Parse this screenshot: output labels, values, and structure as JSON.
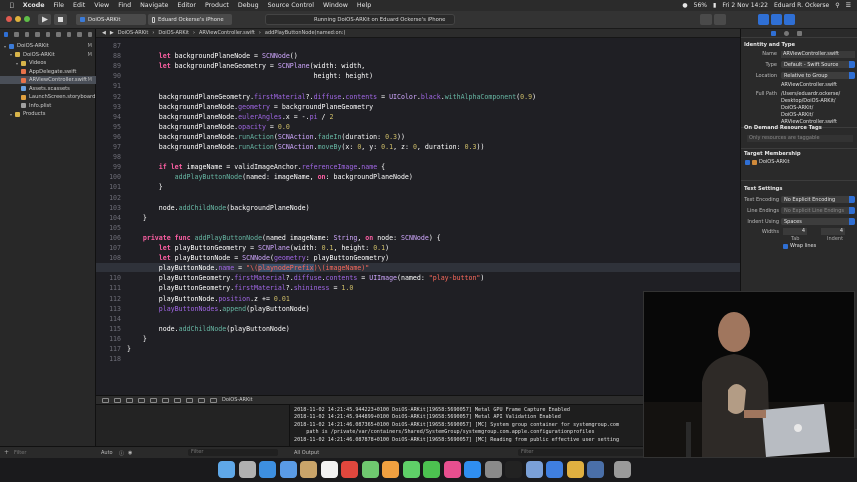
{
  "menubar": {
    "items": [
      "Xcode",
      "File",
      "Edit",
      "View",
      "Find",
      "Navigate",
      "Editor",
      "Product",
      "Debug",
      "Source Control",
      "Window",
      "Help"
    ],
    "battery": "56%",
    "datetime": "Fri 2 Nov 14:22",
    "user": "Eduard R. Ockerse"
  },
  "toolbar": {
    "scheme": "DoiOS-ARKit",
    "device": "Eduard Ockerse's iPhone",
    "activity": "Running DoiOS-ARKit on Eduard Ockerse's iPhone"
  },
  "navigator": {
    "items": [
      {
        "label": "DoiOS-ARKit",
        "badge": "M",
        "level": 0,
        "type": "project"
      },
      {
        "label": "DoiOS-ARKit",
        "badge": "M",
        "level": 1,
        "type": "folder"
      },
      {
        "label": "Videos",
        "badge": "",
        "level": 2,
        "type": "folder"
      },
      {
        "label": "AppDelegate.swift",
        "badge": "",
        "level": 2,
        "type": "swift"
      },
      {
        "label": "ARViewController.swift",
        "badge": "M",
        "level": 2,
        "type": "swift",
        "selected": true
      },
      {
        "label": "Assets.xcassets",
        "badge": "",
        "level": 2,
        "type": "assets"
      },
      {
        "label": "LaunchScreen.storyboard",
        "badge": "",
        "level": 2,
        "type": "storyboard"
      },
      {
        "label": "Info.plist",
        "badge": "",
        "level": 2,
        "type": "plist"
      },
      {
        "label": "Products",
        "badge": "",
        "level": 1,
        "type": "folder"
      }
    ],
    "filter_placeholder": "Filter"
  },
  "jumpbar": {
    "crumbs": [
      "DoiOS-ARKit",
      "DoiOS-ARKit",
      "ARViewController.swift",
      "addPlayButtonNode(named:on:)"
    ]
  },
  "editor": {
    "current_line": 109,
    "lines": [
      {
        "n": 87,
        "t": ""
      },
      {
        "n": 88,
        "t": "        let backgroundPlaneNode = SCNNode()"
      },
      {
        "n": 89,
        "t": "        let backgroundPlaneGeometry = SCNPlane(width: width,"
      },
      {
        "n": 90,
        "t": "                                               height: height)"
      },
      {
        "n": 91,
        "t": ""
      },
      {
        "n": 92,
        "t": "        backgroundPlaneGeometry.firstMaterial?.diffuse.contents = UIColor.black.withAlphaComponent(0.9)"
      },
      {
        "n": 93,
        "t": "        backgroundPlaneNode.geometry = backgroundPlaneGeometry"
      },
      {
        "n": 94,
        "t": "        backgroundPlaneNode.eulerAngles.x = -.pi / 2"
      },
      {
        "n": 95,
        "t": "        backgroundPlaneNode.opacity = 0.0"
      },
      {
        "n": 96,
        "t": "        backgroundPlaneNode.runAction(SCNAction.fadeIn(duration: 0.3))"
      },
      {
        "n": 97,
        "t": "        backgroundPlaneNode.runAction(SCNAction.moveBy(x: 0, y: 0.1, z: 0, duration: 0.3))"
      },
      {
        "n": 98,
        "t": ""
      },
      {
        "n": 99,
        "t": "        if let imageName = validImageAnchor.referenceImage.name {"
      },
      {
        "n": 100,
        "t": "            addPlayButtonNode(named: imageName, on: backgroundPlaneNode)"
      },
      {
        "n": 101,
        "t": "        }"
      },
      {
        "n": 102,
        "t": ""
      },
      {
        "n": 103,
        "t": "        node.addChildNode(backgroundPlaneNode)"
      },
      {
        "n": 104,
        "t": "    }"
      },
      {
        "n": 105,
        "t": ""
      },
      {
        "n": 106,
        "t": "    private func addPlayButtonNode(named imageName: String, on node: SCNNode) {"
      },
      {
        "n": 107,
        "t": "        let playButtonGeometry = SCNPlane(width: 0.1, height: 0.1)"
      },
      {
        "n": 108,
        "t": "        let playButtonNode = SCNNode(geometry: playButtonGeometry)"
      },
      {
        "n": 109,
        "t": "        playButtonNode.name = \"\\(playnodePrefix)\\(imageName)\""
      },
      {
        "n": 110,
        "t": "        playButtonGeometry.firstMaterial?.diffuse.contents = UIImage(named: \"play-button\")"
      },
      {
        "n": 111,
        "t": "        playButtonGeometry.firstMaterial?.shininess = 1.0"
      },
      {
        "n": 112,
        "t": "        playButtonNode.position.z += 0.01"
      },
      {
        "n": 113,
        "t": "        playButtonNodes.append(playButtonNode)"
      },
      {
        "n": 114,
        "t": ""
      },
      {
        "n": 115,
        "t": "        node.addChildNode(playButtonNode)"
      },
      {
        "n": 116,
        "t": "    }"
      },
      {
        "n": 117,
        "t": "}"
      },
      {
        "n": 118,
        "t": ""
      }
    ]
  },
  "debugbar": {
    "target": "DoiOS-ARKit"
  },
  "console": {
    "lines": [
      "2018-11-02 14:21:45.944223+0100 DoiOS-ARKit[19658:5690057] Metal GPU Frame Capture Enabled",
      "2018-11-02 14:21:45.944899+0100 DoiOS-ARKit[19658:5690057] Metal API Validation Enabled",
      "2018-11-02 14:21:46.087365+0100 DoiOS-ARKit[19658:5690057] [MC] System group container for systemgroup.com",
      "    path is /private/var/containers/Shared/SystemGroup/systemgroup.com.apple.configurationprofiles",
      "2018-11-02 14:21:46.087878+0100 DoiOS-ARKit[19658:5690057] [MC] Reading from public effective user setting"
    ],
    "filter_left": "Auto",
    "output_label": "All Output",
    "filter_placeholder": "Filter"
  },
  "inspector": {
    "identity_title": "Identity and Type",
    "name_label": "Name",
    "name_value": "ARViewController.swift",
    "type_label": "Type",
    "type_value": "Default - Swift Source",
    "location_label": "Location",
    "location_value": "Relative to Group",
    "location_file": "ARViewController.swift",
    "fullpath_label": "Full Path",
    "fullpath_value": [
      "/Users/eduardr.ockerse/",
      "Desktop/DoiOS-ARKit/",
      "DoiOS-ARKit/",
      "DoiOS-ARKit/",
      "ARViewController.swift"
    ],
    "odr_title": "On Demand Resource Tags",
    "odr_placeholder": "Only resources are taggable",
    "membership_title": "Target Membership",
    "membership_target": "DoiOS-ARKit",
    "text_title": "Text Settings",
    "encoding_label": "Text Encoding",
    "encoding_value": "No Explicit Encoding",
    "endings_label": "Line Endings",
    "endings_value": "No Explicit Line Endings",
    "indent_label": "Indent Using",
    "indent_value": "Spaces",
    "widths_label": "Widths",
    "tab_width": "4",
    "indent_width": "4",
    "tab_label": "Tab",
    "indent_word": "Indent",
    "wrap_label": "Wrap lines"
  },
  "colors": {
    "accent": "#2f6fd4",
    "keyword": "#fc5fa3",
    "type": "#d0a8ff",
    "function": "#67b7a4",
    "property": "#a167e6",
    "number": "#d0bf69",
    "string": "#fc6a5d"
  },
  "dock": {
    "icons": [
      "finder-icon",
      "launchpad-icon",
      "safari-icon",
      "mail-icon",
      "contacts-icon",
      "calendar-icon",
      "chrome-icon",
      "maps-icon",
      "photos-icon",
      "messages-icon",
      "facetime-icon",
      "itunes-icon",
      "appstore-icon",
      "system-preferences-icon",
      "terminal-icon",
      "preview-icon",
      "xcode-icon",
      "keynote-icon",
      "downloads-icon",
      "trash-icon"
    ]
  }
}
